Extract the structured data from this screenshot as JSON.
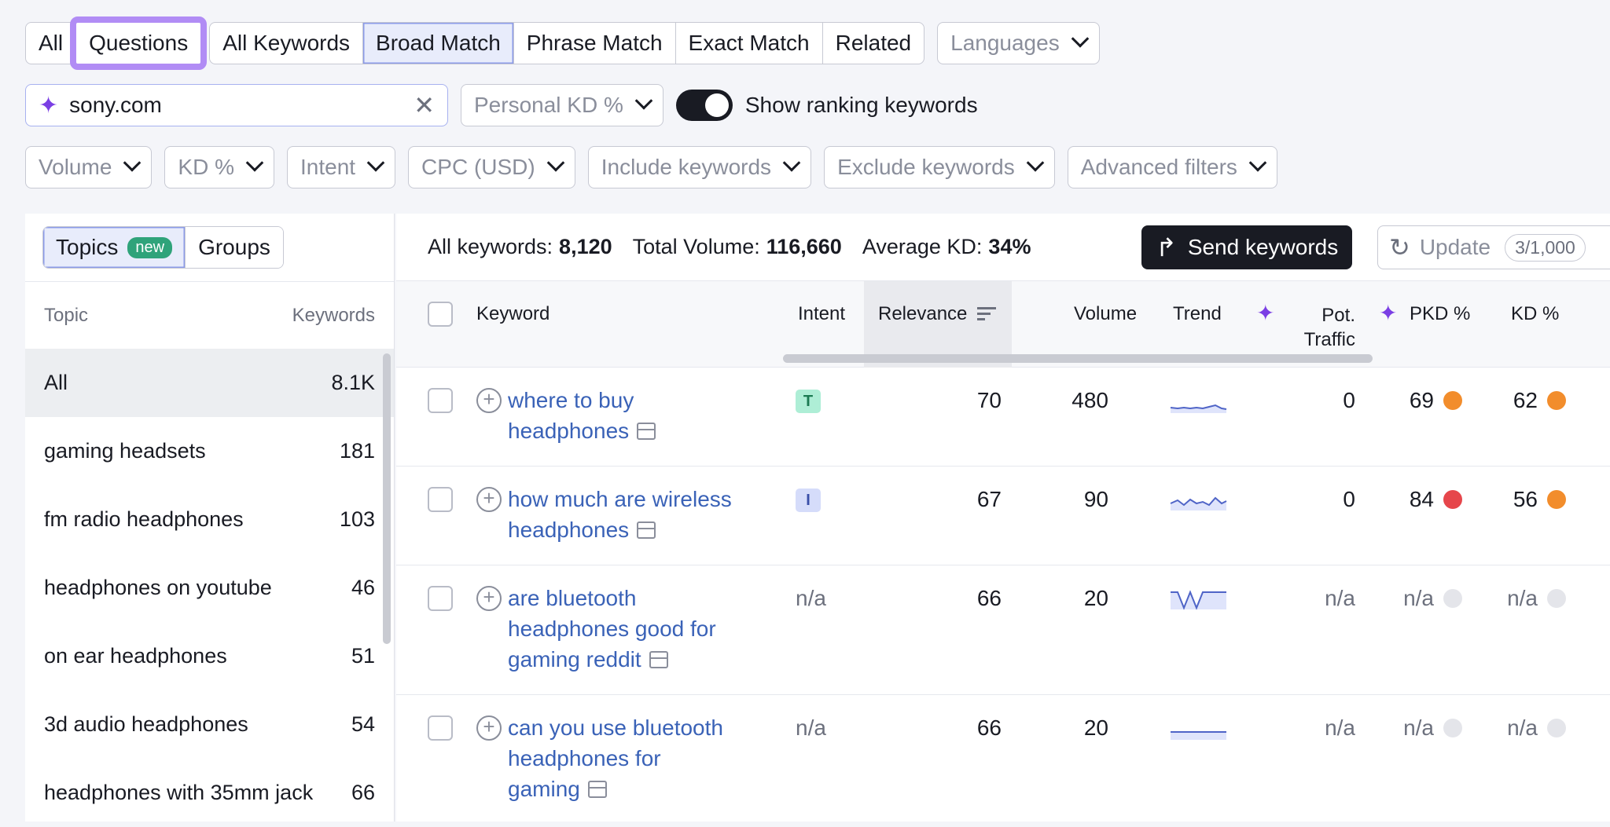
{
  "tabs_scope": [
    {
      "label": "All"
    },
    {
      "label": "Questions"
    }
  ],
  "tabs_match": [
    {
      "label": "All Keywords"
    },
    {
      "label": "Broad Match"
    },
    {
      "label": "Phrase Match"
    },
    {
      "label": "Exact Match"
    },
    {
      "label": "Related"
    }
  ],
  "languages_label": "Languages",
  "search": {
    "value": "sony.com"
  },
  "personal_kd_label": "Personal KD %",
  "show_ranking_label": "Show ranking keywords",
  "filters": [
    {
      "label": "Volume"
    },
    {
      "label": "KD %"
    },
    {
      "label": "Intent"
    },
    {
      "label": "CPC (USD)"
    },
    {
      "label": "Include keywords"
    },
    {
      "label": "Exclude keywords"
    },
    {
      "label": "Advanced filters"
    }
  ],
  "left_panel": {
    "tab_topics": "Topics",
    "tab_topics_badge": "new",
    "tab_groups": "Groups",
    "col_topic": "Topic",
    "col_keywords": "Keywords",
    "topics": [
      {
        "name": "All",
        "count": "8.1K"
      },
      {
        "name": "gaming headsets",
        "count": "181"
      },
      {
        "name": "fm radio headphones",
        "count": "103"
      },
      {
        "name": "headphones on youtube",
        "count": "46"
      },
      {
        "name": "on ear headphones",
        "count": "51"
      },
      {
        "name": "3d audio headphones",
        "count": "54"
      },
      {
        "name": "headphones with 35mm jack",
        "count": "66"
      }
    ]
  },
  "summary": {
    "all_keywords_label": "All keywords:",
    "all_keywords_value": "8,120",
    "total_volume_label": "Total Volume:",
    "total_volume_value": "116,660",
    "avg_kd_label": "Average KD:",
    "avg_kd_value": "34%",
    "send_label": "Send keywords",
    "update_label": "Update",
    "update_count": "3/1,000"
  },
  "columns": {
    "keyword": "Keyword",
    "intent": "Intent",
    "relevance": "Relevance",
    "volume": "Volume",
    "trend": "Trend",
    "pot_traffic_1": "Pot.",
    "pot_traffic_2": "Traffic",
    "pkd": "PKD %",
    "kd": "KD %"
  },
  "rows": [
    {
      "kw1": "where to buy",
      "kw2": "headphones",
      "kw3": "",
      "intent": "T",
      "relevance": "70",
      "volume": "480",
      "pot_traffic": "0",
      "pkd": "69",
      "pkd_color": "#f28d2c",
      "kd": "62",
      "kd_color": "#f28d2c"
    },
    {
      "kw1": "how much are wireless",
      "kw2": "headphones",
      "kw3": "",
      "intent": "I",
      "relevance": "67",
      "volume": "90",
      "pot_traffic": "0",
      "pkd": "84",
      "pkd_color": "#e6464b",
      "kd": "56",
      "kd_color": "#f28d2c"
    },
    {
      "kw1": "are bluetooth",
      "kw2": "headphones good for",
      "kw3": "gaming reddit",
      "intent": "n/a",
      "relevance": "66",
      "volume": "20",
      "pot_traffic": "n/a",
      "pkd": "n/a",
      "pkd_color": "#e4e5ea",
      "kd": "n/a",
      "kd_color": "#e4e5ea"
    },
    {
      "kw1": "can you use bluetooth",
      "kw2": "headphones for",
      "kw3": "gaming",
      "intent": "n/a",
      "relevance": "66",
      "volume": "20",
      "pot_traffic": "n/a",
      "pkd": "n/a",
      "pkd_color": "#e4e5ea",
      "kd": "n/a",
      "kd_color": "#e4e5ea"
    }
  ],
  "icons": {
    "sparkle": "sparkle-icon",
    "clear": "close-icon",
    "chevron": "chevron-down-icon",
    "sort": "sort-icon",
    "send": "share-arrow-icon",
    "update": "refresh-icon",
    "add": "plus-circle-icon",
    "serp": "serp-features-icon"
  }
}
